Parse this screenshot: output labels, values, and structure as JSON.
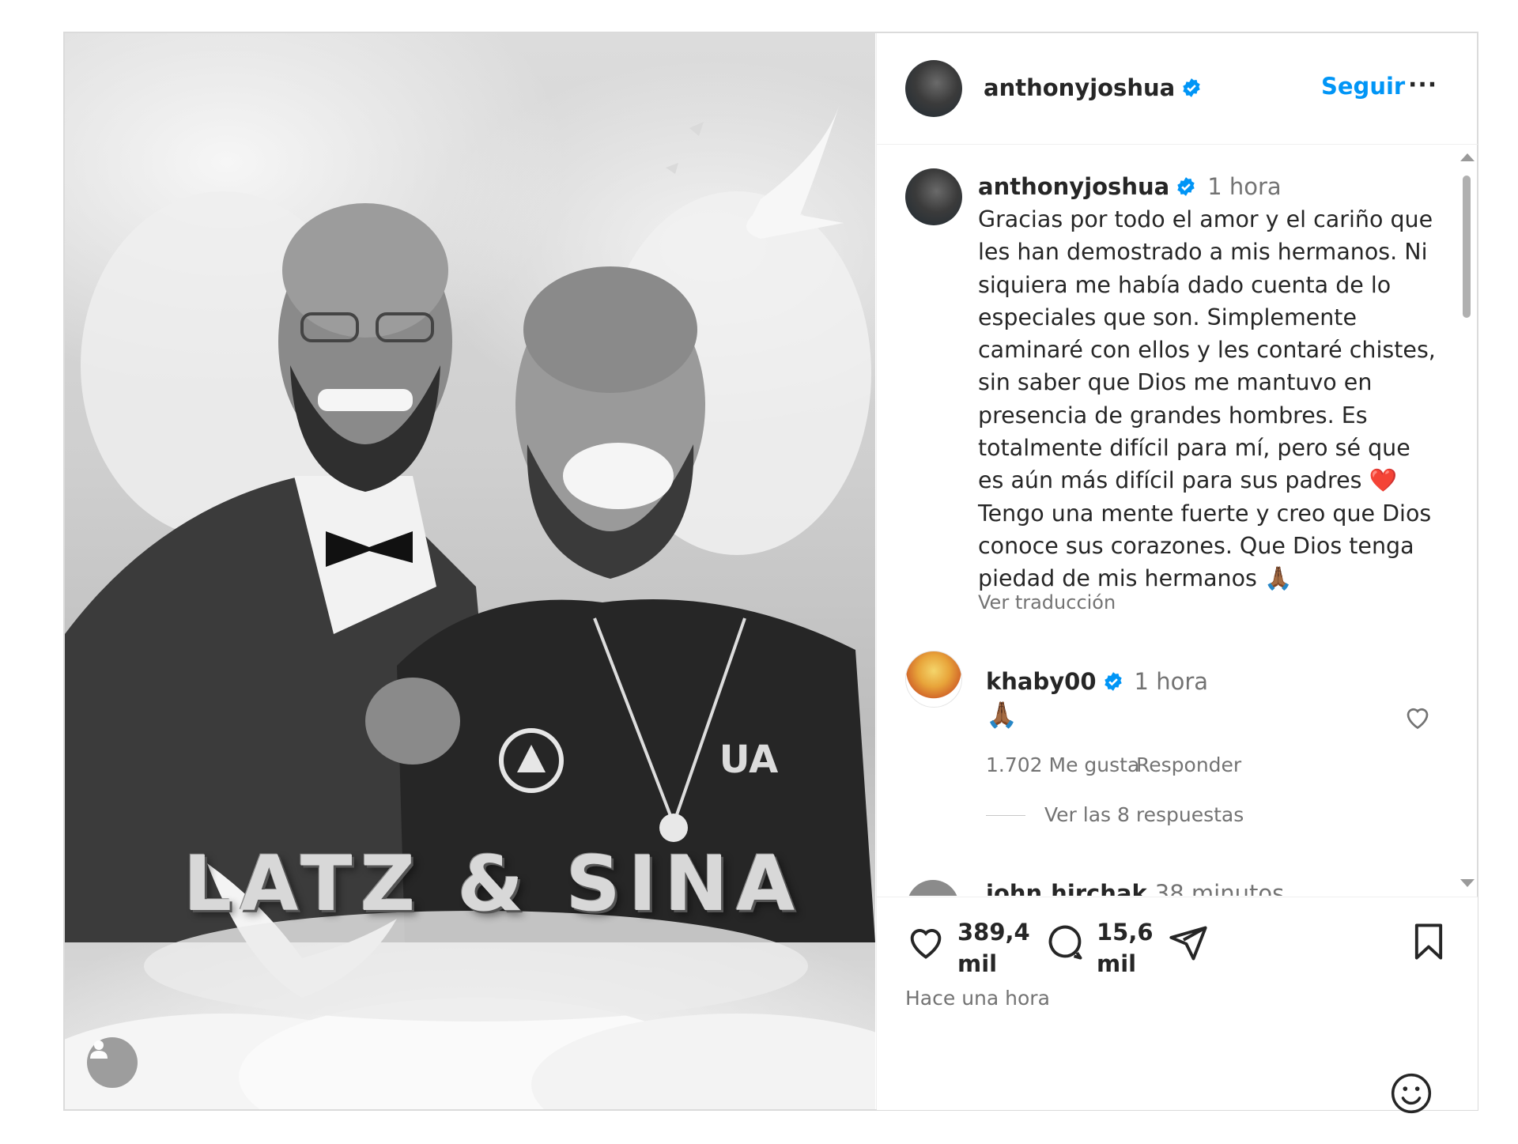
{
  "media": {
    "title_overlay": "LATZ & SINA"
  },
  "header": {
    "username": "anthonyjoshua",
    "follow_label": "Seguir",
    "more_label": "···"
  },
  "caption": {
    "username": "anthonyjoshua",
    "time": "1 hora",
    "text": "Gracias por todo el amor y el cariño que les han demostrado a mis hermanos. Ni siquiera me había dado cuenta de lo especiales que son. Simplemente caminaré con ellos y les contaré chistes, sin saber que Dios me mantuvo en presencia de grandes hombres. Es totalmente difícil para mí, pero sé que es aún más difícil para sus padres ❤️ Tengo una mente fuerte y creo que Dios conoce sus corazones. Que Dios tenga piedad de mis hermanos 🙏🏾",
    "translate_label": "Ver traducción"
  },
  "comments": [
    {
      "username": "khaby00",
      "time": "1 hora",
      "text": "🙏🏾",
      "likes": "1.702 Me gusta",
      "reply_label": "Responder",
      "view_replies": "Ver las 8 respuestas"
    },
    {
      "username": "john.hirchak",
      "time": "38 minutos"
    }
  ],
  "actions": {
    "likes_count": "389,4",
    "likes_unit": "mil",
    "comments_count": "15,6",
    "comments_unit": "mil",
    "posted_time": "Hace una hora"
  },
  "colors": {
    "accent": "#0095f6",
    "text": "#262626",
    "secondary": "#737373",
    "heart_red": "#e0245e"
  },
  "icons": {
    "verified": "verified-badge-icon",
    "like": "heart-icon",
    "comment": "comment-bubble-icon",
    "share": "paper-plane-icon",
    "save": "bookmark-icon",
    "emoji": "smiley-icon",
    "user_tag": "user-icon"
  }
}
